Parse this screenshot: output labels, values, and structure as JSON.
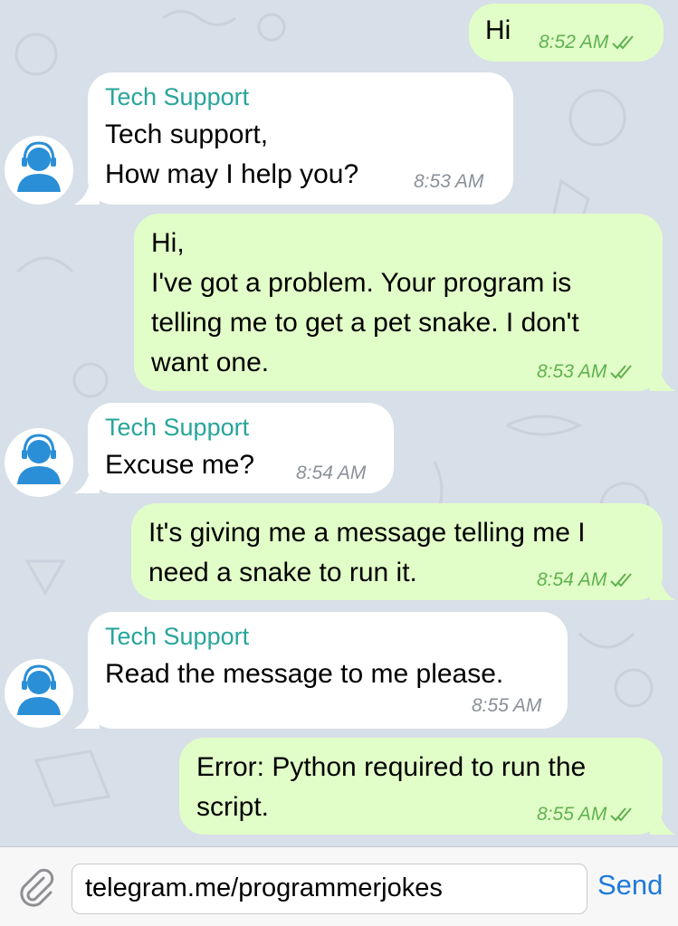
{
  "messages": [
    {
      "direction": "outgoing",
      "lines": [
        "Hi"
      ],
      "time": "8:52 AM",
      "read": true
    },
    {
      "direction": "incoming",
      "sender": "Tech Support",
      "lines": [
        "Tech support,",
        "How may I help you?"
      ],
      "time": "8:53 AM"
    },
    {
      "direction": "outgoing",
      "lines": [
        "Hi,",
        "I've got a problem. Your program is",
        "telling me to get a pet snake. I don't",
        "want one."
      ],
      "time": "8:53 AM",
      "read": true
    },
    {
      "direction": "incoming",
      "sender": "Tech Support",
      "lines": [
        "Excuse me?"
      ],
      "time": "8:54 AM"
    },
    {
      "direction": "outgoing",
      "lines": [
        "It's giving me a message telling me I",
        "need a snake to run it."
      ],
      "time": "8:54 AM",
      "read": true
    },
    {
      "direction": "incoming",
      "sender": "Tech Support",
      "lines": [
        "Read the message to me please."
      ],
      "time": "8:55 AM"
    },
    {
      "direction": "outgoing",
      "lines": [
        "Error: Python required to run the",
        "script."
      ],
      "time": "8:55 AM",
      "read": true
    }
  ],
  "composer": {
    "input_value": "telegram.me/programmerjokes",
    "send_label": "Send",
    "attach_icon": "paperclip-icon"
  },
  "colors": {
    "chat_background": "#d7dfe8",
    "outgoing_bubble": "#e2fec8",
    "incoming_bubble": "#ffffff",
    "sender_name": "#27a59a",
    "outgoing_time": "#5fb151",
    "incoming_time": "#8a9099",
    "send_button": "#1f7ad9",
    "avatar": "#2a8fd6"
  }
}
